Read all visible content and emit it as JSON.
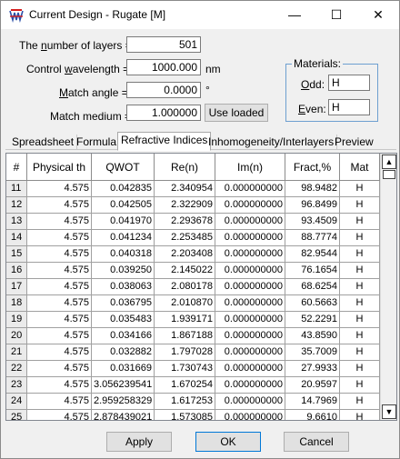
{
  "window": {
    "title": "Current Design - Rugate [M]",
    "minimize": "—",
    "maximize": "☐",
    "close": "✕"
  },
  "form": {
    "layers_pre": "The ",
    "layers_u": "n",
    "layers_post": "umber of layers =",
    "layers_value": "501",
    "wave_pre": "Control ",
    "wave_u": "w",
    "wave_post": "avelength =",
    "wave_value": "1000.000",
    "wave_unit": "nm",
    "angle_pre": "",
    "angle_u": "M",
    "angle_post": "atch angle =",
    "angle_value": "0.0000",
    "angle_unit": "°",
    "medium_label": "Match medium =",
    "medium_value": "1.000000",
    "use_loaded": "Use loaded"
  },
  "materials": {
    "title": "Materials:",
    "odd_u": "O",
    "odd_post": "dd:",
    "odd_value": "H",
    "even_u": "E",
    "even_post": "ven:",
    "even_value": "H"
  },
  "tabs": [
    "Spreadsheet",
    "Formula",
    "Refractive Indices",
    "Inhomogeneity/Interlayers",
    "Preview"
  ],
  "table": {
    "headers": [
      "#",
      "Physical th",
      "QWOT",
      "Re(n)",
      "Im(n)",
      "Fract,%",
      "Mat"
    ],
    "rows": [
      [
        "11",
        "4.575",
        "0.042835",
        "2.340954",
        "0.000000000",
        "98.9482",
        "H"
      ],
      [
        "12",
        "4.575",
        "0.042505",
        "2.322909",
        "0.000000000",
        "96.8499",
        "H"
      ],
      [
        "13",
        "4.575",
        "0.041970",
        "2.293678",
        "0.000000000",
        "93.4509",
        "H"
      ],
      [
        "14",
        "4.575",
        "0.041234",
        "2.253485",
        "0.000000000",
        "88.7774",
        "H"
      ],
      [
        "15",
        "4.575",
        "0.040318",
        "2.203408",
        "0.000000000",
        "82.9544",
        "H"
      ],
      [
        "16",
        "4.575",
        "0.039250",
        "2.145022",
        "0.000000000",
        "76.1654",
        "H"
      ],
      [
        "17",
        "4.575",
        "0.038063",
        "2.080178",
        "0.000000000",
        "68.6254",
        "H"
      ],
      [
        "18",
        "4.575",
        "0.036795",
        "2.010870",
        "0.000000000",
        "60.5663",
        "H"
      ],
      [
        "19",
        "4.575",
        "0.035483",
        "1.939171",
        "0.000000000",
        "52.2291",
        "H"
      ],
      [
        "20",
        "4.575",
        "0.034166",
        "1.867188",
        "0.000000000",
        "43.8590",
        "H"
      ],
      [
        "21",
        "4.575",
        "0.032882",
        "1.797028",
        "0.000000000",
        "35.7009",
        "H"
      ],
      [
        "22",
        "4.575",
        "0.031669",
        "1.730743",
        "0.000000000",
        "27.9933",
        "H"
      ],
      [
        "23",
        "4.575",
        "3.056239541",
        "1.670254",
        "0.000000000",
        "20.9597",
        "H"
      ],
      [
        "24",
        "4.575",
        "2.959258329",
        "1.617253",
        "0.000000000",
        "14.7969",
        "H"
      ],
      [
        "25",
        "4.575",
        "2.878439021",
        "1.573085",
        "0.000000000",
        "9.6610",
        "H"
      ]
    ]
  },
  "buttons": {
    "apply": "Apply",
    "ok": "OK",
    "cancel": "Cancel"
  },
  "colors": {
    "accent": "#0078d7",
    "icon_red": "#d41e1e",
    "icon_blue": "#2b4fa8"
  }
}
